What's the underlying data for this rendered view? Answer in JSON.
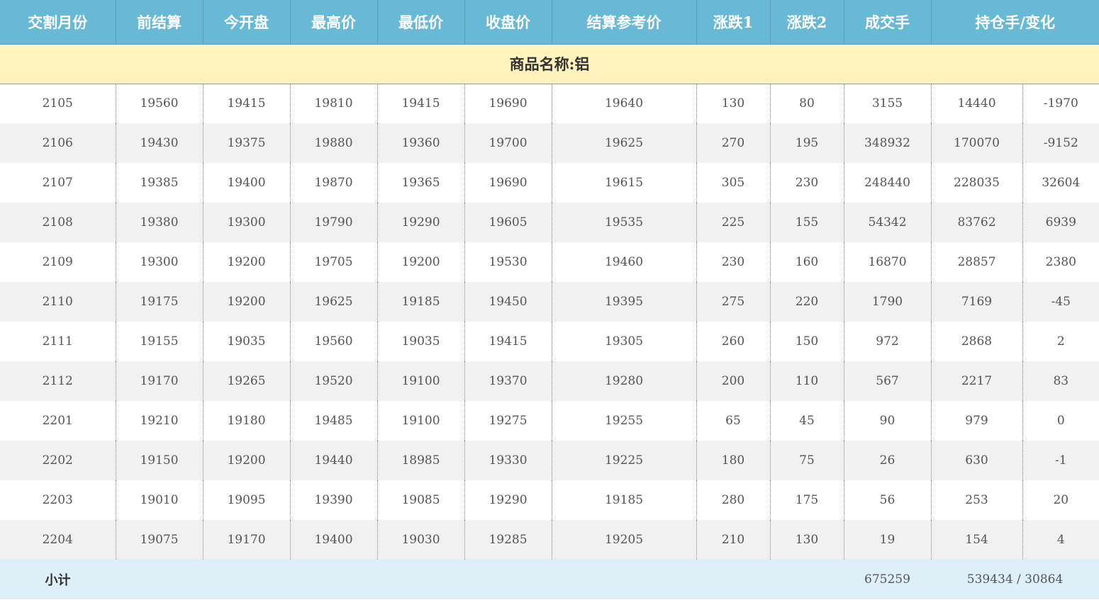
{
  "headers": [
    "交割月份",
    "前结算",
    "今开盘",
    "最高价",
    "最低价",
    "收盘价",
    "结算参考价",
    "涨跌1",
    "涨跌2",
    "成交手",
    "持仓手/变化"
  ],
  "category": "商品名称:铝",
  "rows": [
    [
      "2105",
      "19560",
      "19415",
      "19810",
      "19415",
      "19690",
      "19640",
      "130",
      "80",
      "3155",
      "14440",
      "-1970"
    ],
    [
      "2106",
      "19430",
      "19375",
      "19880",
      "19360",
      "19700",
      "19625",
      "270",
      "195",
      "348932",
      "170070",
      "-9152"
    ],
    [
      "2107",
      "19385",
      "19400",
      "19870",
      "19365",
      "19690",
      "19615",
      "305",
      "230",
      "248440",
      "228035",
      "32604"
    ],
    [
      "2108",
      "19380",
      "19300",
      "19790",
      "19290",
      "19605",
      "19535",
      "225",
      "155",
      "54342",
      "83762",
      "6939"
    ],
    [
      "2109",
      "19300",
      "19200",
      "19705",
      "19200",
      "19530",
      "19460",
      "230",
      "160",
      "16870",
      "28857",
      "2380"
    ],
    [
      "2110",
      "19175",
      "19200",
      "19625",
      "19185",
      "19450",
      "19395",
      "275",
      "220",
      "1790",
      "7169",
      "-45"
    ],
    [
      "2111",
      "19155",
      "19035",
      "19560",
      "19035",
      "19415",
      "19305",
      "260",
      "150",
      "972",
      "2868",
      "2"
    ],
    [
      "2112",
      "19170",
      "19265",
      "19520",
      "19100",
      "19370",
      "19280",
      "200",
      "110",
      "567",
      "2217",
      "83"
    ],
    [
      "2201",
      "19210",
      "19180",
      "19485",
      "19100",
      "19275",
      "19255",
      "65",
      "45",
      "90",
      "979",
      "0"
    ],
    [
      "2202",
      "19150",
      "19200",
      "19440",
      "18985",
      "19330",
      "19225",
      "180",
      "75",
      "26",
      "630",
      "-1"
    ],
    [
      "2203",
      "19010",
      "19095",
      "19390",
      "19085",
      "19290",
      "19185",
      "280",
      "175",
      "56",
      "253",
      "20"
    ],
    [
      "2204",
      "19075",
      "19170",
      "19400",
      "19030",
      "19285",
      "19205",
      "210",
      "130",
      "19",
      "154",
      "4"
    ]
  ],
  "total": {
    "label": "小计",
    "volume": "675259",
    "open_interest": "539434 / 30864"
  }
}
